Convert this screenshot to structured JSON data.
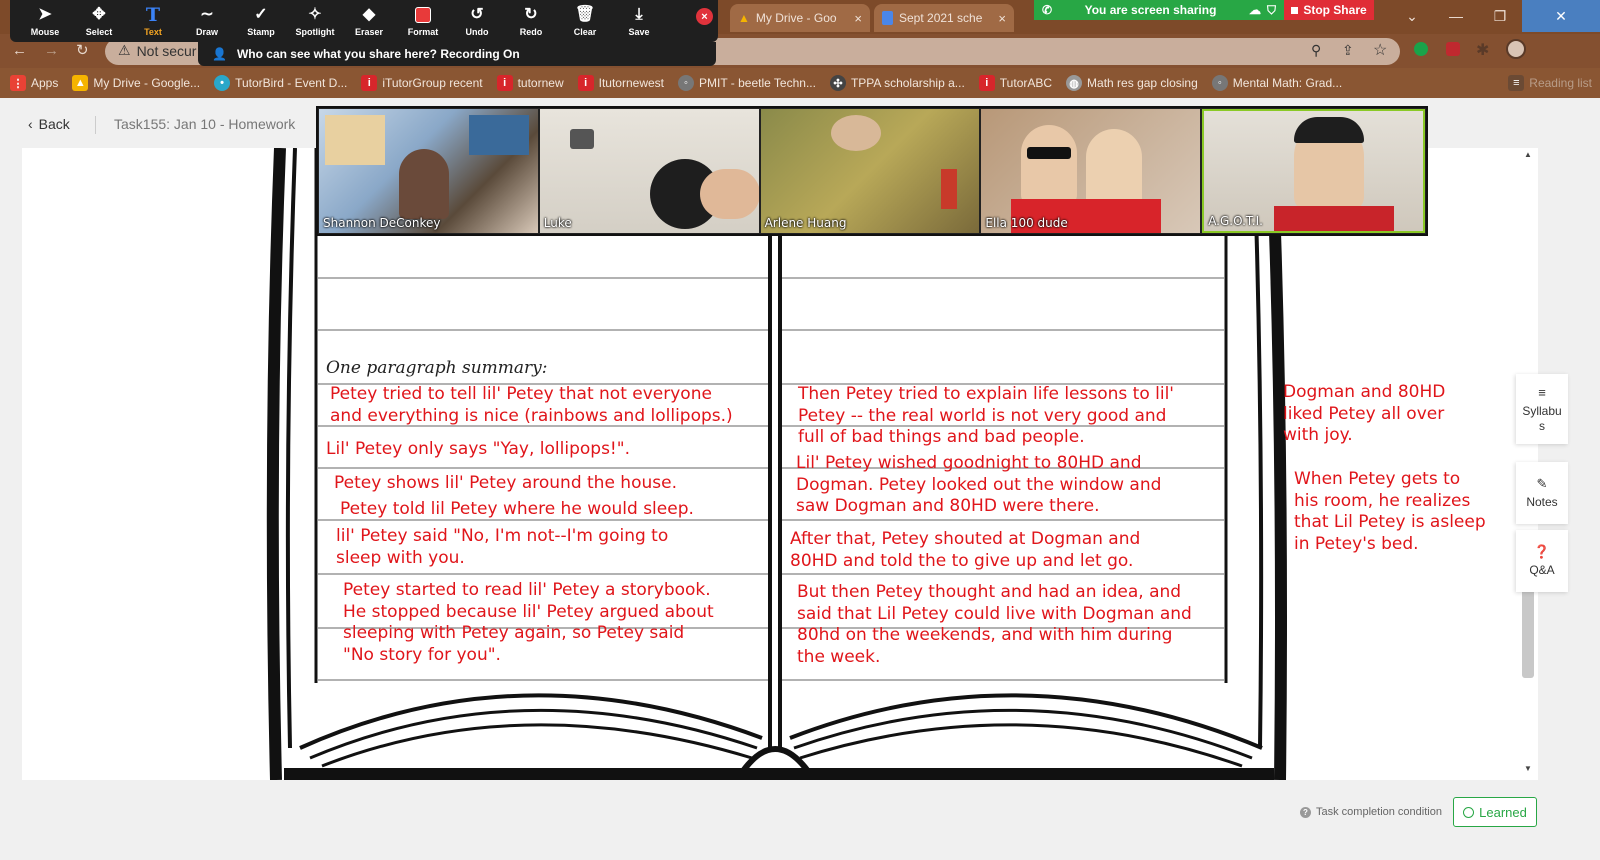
{
  "zoom_toolbar": {
    "tools": [
      {
        "label": "Mouse",
        "icon": "cursor-icon"
      },
      {
        "label": "Select",
        "icon": "move-icon"
      },
      {
        "label": "Text",
        "icon": "text-icon"
      },
      {
        "label": "Draw",
        "icon": "draw-icon"
      },
      {
        "label": "Stamp",
        "icon": "stamp-icon"
      },
      {
        "label": "Spotlight",
        "icon": "spotlight-icon"
      },
      {
        "label": "Eraser",
        "icon": "eraser-icon"
      },
      {
        "label": "Format",
        "icon": "format-icon"
      },
      {
        "label": "Undo",
        "icon": "undo-icon"
      },
      {
        "label": "Redo",
        "icon": "redo-icon"
      },
      {
        "label": "Clear",
        "icon": "trash-icon"
      },
      {
        "label": "Save",
        "icon": "save-icon"
      }
    ],
    "active_tool": "Text",
    "recording_tip": "Who can see what you share here? Recording On"
  },
  "screen_share": {
    "banner_text": "You are screen sharing",
    "stop_label": "Stop Share"
  },
  "browser": {
    "tabs": [
      {
        "label": "My Drive - Goo"
      },
      {
        "label": "Sept 2021 sche"
      }
    ],
    "address_warning": "Not secur",
    "bookmarks": [
      {
        "label": "Apps",
        "color": "#e94235"
      },
      {
        "label": "My Drive - Google...",
        "color": "#f5b400"
      },
      {
        "label": "TutorBird - Event D...",
        "color": "#2aa7c9"
      },
      {
        "label": "iTutorGroup recent",
        "color": "#d7262b"
      },
      {
        "label": "tutornew",
        "color": "#d7262b"
      },
      {
        "label": "Itutornewest",
        "color": "#d7262b"
      },
      {
        "label": "PMIT - beetle Techn...",
        "color": "#777777"
      },
      {
        "label": "TPPA scholarship a...",
        "color": "#444444"
      },
      {
        "label": "TutorABC",
        "color": "#d7262b"
      },
      {
        "label": "Math res gap closing",
        "color": "#999999"
      },
      {
        "label": "Mental Math: Grad...",
        "color": "#777777"
      },
      {
        "label": "Reading list",
        "color": "#6b4a34"
      }
    ]
  },
  "page": {
    "back_label": "Back",
    "task_title": "Task155:  Jan 10 - Homework",
    "summary_heading": "One paragraph summary:",
    "left_column": [
      "Petey tried to tell lil' Petey that not everyone\nand everything is nice (rainbows and lollipops.)",
      "Lil' Petey only says \"Yay, lollipops!\".",
      "Petey shows lil' Petey around the house.",
      "Petey told lil Petey where he would sleep.",
      "lil' Petey said \"No, I'm not--I'm going to\nsleep with you.",
      "Petey started to read lil' Petey a storybook.\nHe stopped because lil' Petey argued about\nsleeping with Petey again, so Petey said\n\"No story for you\"."
    ],
    "right_column": [
      "Then Petey tried to explain life lessons to lil'\nPetey -- the real world is not very good and\nfull of bad things and bad people.",
      "Lil' Petey wished goodnight to 80HD and\nDogman.  Petey looked out the window and\nsaw Dogman and 80HD were there.",
      "After that, Petey shouted at Dogman and\n80HD and told the to give up and let go.",
      "But then Petey thought and had an idea, and\nsaid that Lil Petey could live with Dogman and\n80hd on the weekends, and with him during\nthe week."
    ],
    "margin_notes": [
      "Dogman and 80HD\nliked Petey all over\nwith joy.",
      "When Petey gets to\nhis room, he realizes\nthat Lil Petey is asleep\nin Petey's bed."
    ],
    "side_panel": [
      {
        "label": "Syllabu\ns",
        "icon": "list-icon"
      },
      {
        "label": "Notes",
        "icon": "pencil-icon"
      },
      {
        "label": "Q&A",
        "icon": "question-icon"
      }
    ],
    "completion_label": "Task completion condition",
    "learned_label": "Learned",
    "text_color": "#e0151a"
  },
  "participants": [
    {
      "name": "Shannon DeConkey"
    },
    {
      "name": "Luke"
    },
    {
      "name": "Arlene Huang"
    },
    {
      "name": "Ella 100 dude"
    },
    {
      "name": "A.G.O.T.I."
    }
  ]
}
